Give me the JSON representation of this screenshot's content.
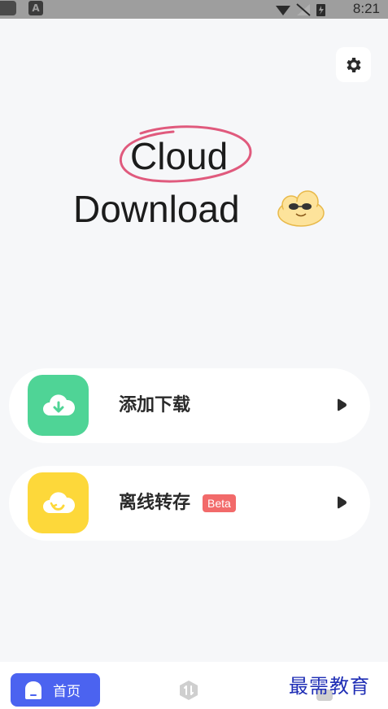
{
  "status_bar": {
    "time": "8:21",
    "indicator_letter": "A",
    "icons": [
      "wifi-icon",
      "no-signal-icon",
      "battery-charging-icon"
    ]
  },
  "header": {
    "settings_icon": "gear-icon"
  },
  "hero": {
    "title_line1": "Cloud",
    "title_line2": "Download",
    "mascot": "cloud-sunglasses-mascot"
  },
  "actions": [
    {
      "label": "添加下载",
      "icon": "cloud-download-icon",
      "color": "#4fd496",
      "badge": ""
    },
    {
      "label": "离线转存",
      "icon": "cloud-sync-icon",
      "color": "#fdd83a",
      "badge": "Beta"
    }
  ],
  "bottom_nav": {
    "home_label": "首页",
    "home_icon": "home-icon",
    "middle_icon": "transfer-icon",
    "right_icon": "profile-icon"
  },
  "watermark": "最需教育",
  "colors": {
    "accent": "#4b63f0",
    "badge": "#f26a6a",
    "circle": "#e05a7d"
  }
}
